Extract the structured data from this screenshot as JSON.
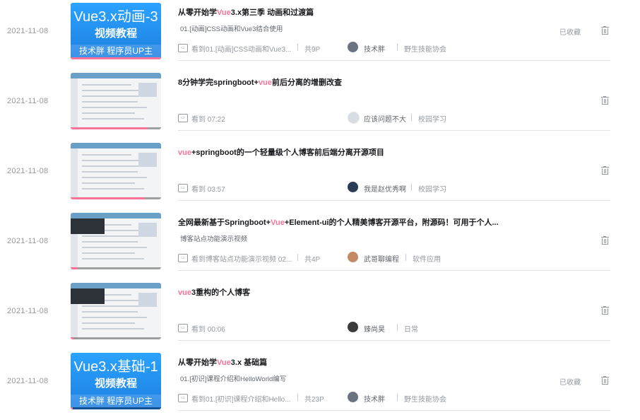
{
  "colors": {
    "accent": "#fb7299",
    "muted": "#9499a0"
  },
  "items": [
    {
      "date": "2021-11-08",
      "thumb": {
        "kind": "blue",
        "line1": "Vue3.x动画-3",
        "line2": "视频教程",
        "line3": "技术胖  程序员UP主",
        "progress": 1.0
      },
      "title_pre": "从零开始学",
      "title_hl": "Vue",
      "title_post": "3.x第三季 动画和过渡篇",
      "subtitle": "01.[动画]CSS动画和Vue3结合使用",
      "progress_text": "看到01.[动画]CSS动画和Vue3...",
      "count": "共9P",
      "uploader": "技术胖",
      "tag": "野生技能协会",
      "fav": "已收藏"
    },
    {
      "date": "2021-11-08",
      "thumb": {
        "kind": "shot",
        "progress": 0.85
      },
      "title_pre": "8分钟学完springboot+",
      "title_hl": "vue",
      "title_post": "前后分离的增删改查",
      "subtitle": "",
      "progress_text": "看到  07:22",
      "count": "",
      "uploader": "应该问题不大",
      "tag": "校园学习",
      "fav": ""
    },
    {
      "date": "2021-11-08",
      "thumb": {
        "kind": "shot",
        "progress": 0.82
      },
      "title_pre": "",
      "title_hl": "vue",
      "title_post": "+springboot的一个轻量级个人博客前后端分离开源项目",
      "subtitle": "",
      "progress_text": "看到  03:57",
      "count": "",
      "uploader": "我是赵优秀啊",
      "tag": "校园学习",
      "fav": ""
    },
    {
      "date": "2021-11-08",
      "thumb": {
        "kind": "shot",
        "progress": 0.08
      },
      "title_pre": "全网最新基于Springboot+",
      "title_hl": "Vue",
      "title_post": "+Element-ui的个人精美博客开源平台，附源码！可用于个人...",
      "subtitle": "博客站点功能演示视频",
      "progress_text": "看到博客站点功能演示视频  02...",
      "count": "共4P",
      "uploader": "武哥聊编程",
      "tag": "软件应用",
      "fav": ""
    },
    {
      "date": "2021-11-08",
      "thumb": {
        "kind": "shot",
        "progress": 0.03
      },
      "title_pre": "",
      "title_hl": "vue",
      "title_post": "3重构的个人博客",
      "subtitle": "",
      "progress_text": "看到  00:06",
      "count": "",
      "uploader": "臻尚昊",
      "tag": "日常",
      "fav": ""
    },
    {
      "date": "2021-11-08",
      "thumb": {
        "kind": "blue",
        "line1": "Vue3.x基础-1",
        "line2": "视频教程",
        "line3": "技术胖  程序员UP主",
        "progress": 0.02
      },
      "title_pre": "从零开始学",
      "title_hl": "Vue",
      "title_post": "3.x 基础篇",
      "subtitle": "01.[初识]课程介绍和HelloWorld编写",
      "progress_text": "看到01.[初识]课程介绍和Hello...",
      "count": "共23P",
      "uploader": "技术胖",
      "tag": "野生技能协会",
      "fav": "已收藏"
    }
  ]
}
